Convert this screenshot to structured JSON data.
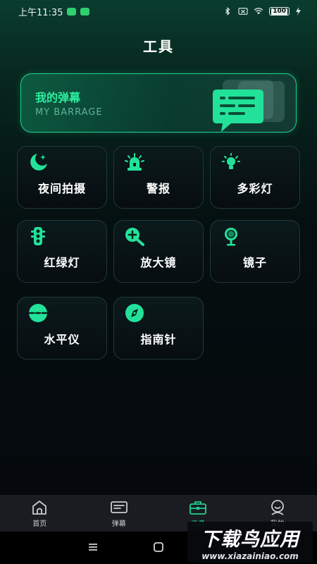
{
  "status_bar": {
    "time": "上午11:35",
    "battery": "100"
  },
  "page": {
    "title": "工具"
  },
  "banner": {
    "title": "我的弹幕",
    "subtitle": "MY BARRAGE"
  },
  "tools": [
    {
      "label": "夜间拍摄",
      "icon": "moon-icon"
    },
    {
      "label": "警报",
      "icon": "siren-icon"
    },
    {
      "label": "多彩灯",
      "icon": "bulb-icon"
    },
    {
      "label": "红绿灯",
      "icon": "traffic-light-icon"
    },
    {
      "label": "放大镜",
      "icon": "magnifier-icon"
    },
    {
      "label": "镜子",
      "icon": "mirror-icon"
    },
    {
      "label": "水平仪",
      "icon": "level-icon"
    },
    {
      "label": "指南针",
      "icon": "compass-icon"
    }
  ],
  "tab_bar": {
    "items": [
      {
        "label": "首页",
        "icon": "home-icon"
      },
      {
        "label": "弹幕",
        "icon": "barrage-icon"
      },
      {
        "label": "工具",
        "icon": "toolbox-icon",
        "active": true
      },
      {
        "label": "我的",
        "icon": "profile-icon"
      }
    ]
  },
  "watermark": {
    "main": "下载鸟应用",
    "sub": "www.xiazainiao.com"
  },
  "colors": {
    "accent": "#1fd48f",
    "background": "#05070c",
    "tab_bar": "#1a1c21"
  }
}
